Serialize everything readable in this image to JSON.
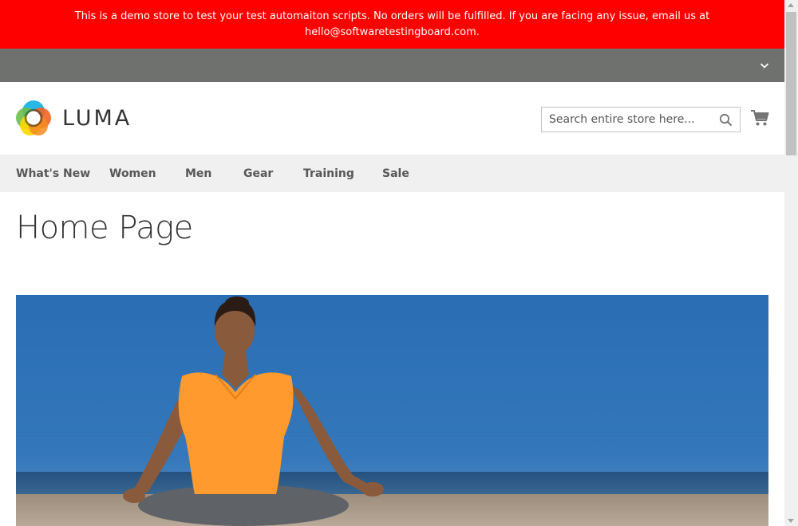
{
  "demo_notice": {
    "line1": "This is a demo store to test your test automaiton scripts. No orders will be fulfilled. If you are facing any issue, email us at",
    "line2": "hello@softwaretestingboard.com."
  },
  "header": {
    "logo_text": "LUMA",
    "search_placeholder": "Search entire store here...",
    "search_value": ""
  },
  "nav": {
    "items": [
      {
        "label": "What's New"
      },
      {
        "label": "Women"
      },
      {
        "label": "Men"
      },
      {
        "label": "Gear"
      },
      {
        "label": "Training"
      },
      {
        "label": "Sale"
      }
    ]
  },
  "page": {
    "title": "Home Page"
  },
  "colors": {
    "notice_bg": "#ff0000",
    "panel_bg": "#6e716e",
    "nav_bg": "#f0f0f0",
    "text": "#333333",
    "sky": "#2f71b4",
    "shirt": "#ff9933"
  },
  "icons": {
    "panel_toggle": "chevron-down-icon",
    "search": "search-icon",
    "cart": "cart-icon"
  }
}
